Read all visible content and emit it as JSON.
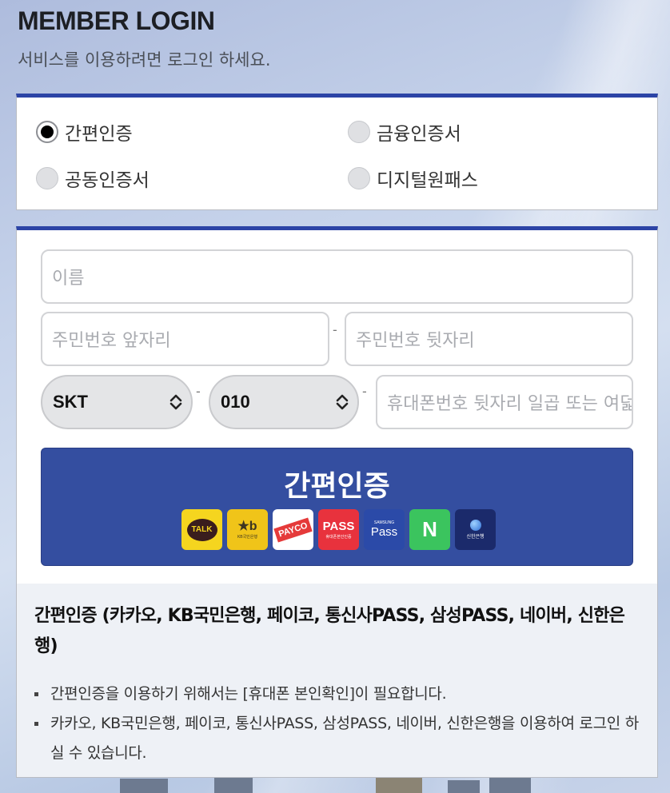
{
  "header": {
    "title": "MEMBER LOGIN",
    "subtitle": "서비스를 이용하려면 로그인 하세요."
  },
  "auth_methods": {
    "selected": "간편인증",
    "options": [
      "간편인증",
      "금융인증서",
      "공동인증서",
      "디지털원패스"
    ]
  },
  "form": {
    "name_placeholder": "이름",
    "rrn_front_placeholder": "주민번호 앞자리",
    "rrn_back_placeholder": "주민번호 뒷자리",
    "carrier_value": "SKT",
    "prefix_value": "010",
    "phone_placeholder": "휴대폰번호 뒷자리 일곱 또는 여덟자리",
    "dash": "-"
  },
  "auth_button": {
    "label": "간편인증",
    "providers": [
      {
        "name": "kakao",
        "icon": "kakao-talk-icon",
        "text": "TALK",
        "color": "#f5d51f"
      },
      {
        "name": "kb",
        "icon": "kb-bank-icon",
        "text": "KB국민은행",
        "color": "#f0c419"
      },
      {
        "name": "payco",
        "icon": "payco-icon",
        "text": "PAYCO",
        "color": "#ffffff"
      },
      {
        "name": "pass",
        "icon": "pass-icon",
        "text": "PASS",
        "sub": "휴대폰본인인증",
        "color": "#e8323d"
      },
      {
        "name": "samsung-pass",
        "icon": "samsung-pass-icon",
        "text": "Pass",
        "sub": "SAMSUNG",
        "color": "#2b4aa8"
      },
      {
        "name": "naver",
        "icon": "naver-icon",
        "text": "N",
        "color": "#3bc45e"
      },
      {
        "name": "shinhan",
        "icon": "shinhan-bank-icon",
        "text": "신한은행",
        "color": "#1b2a6b"
      }
    ]
  },
  "info": {
    "title": "간편인증 (카카오, KB국민은행, 페이코, 통신사PASS, 삼성PASS, 네이버, 신한은행)",
    "bullets": [
      "간편인증을 이용하기 위해서는 [휴대폰 본인확인]이 필요합니다.",
      "카카오, KB국민은행, 페이코, 통신사PASS, 삼성PASS, 네이버, 신한은행을 이용하여 로그인 하실 수 있습니다."
    ]
  },
  "colors": {
    "accent": "#2c44a6",
    "button": "#344ea0"
  }
}
